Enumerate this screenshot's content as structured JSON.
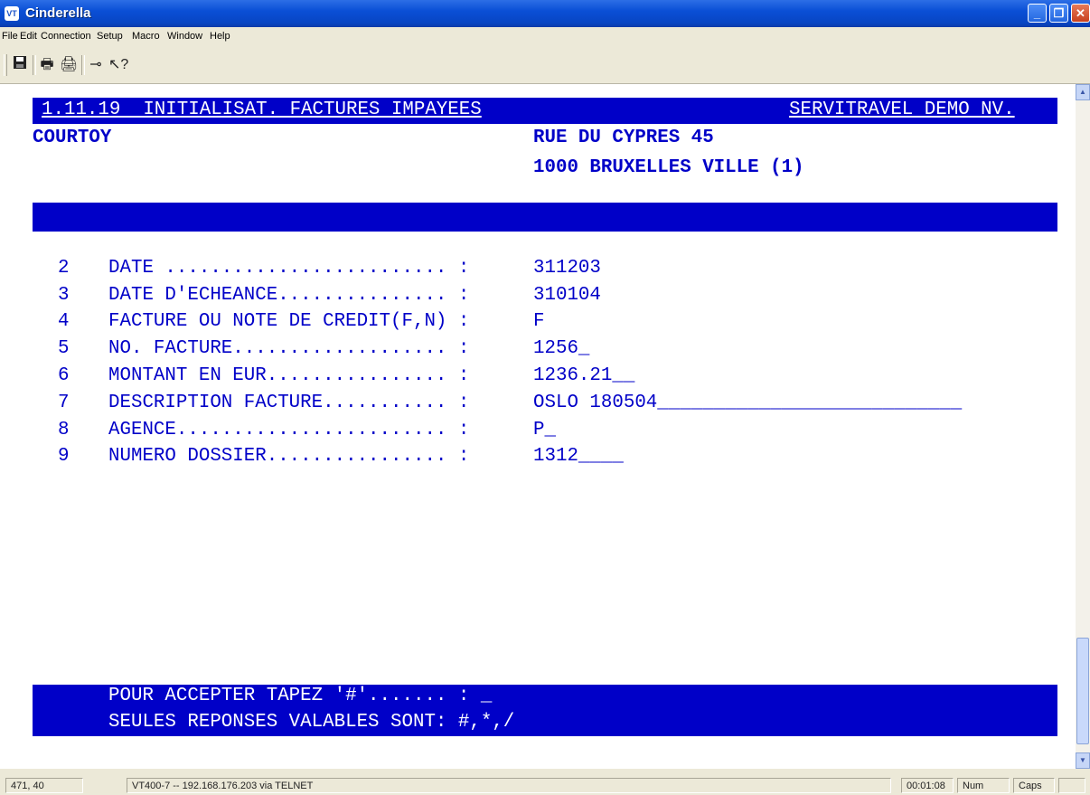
{
  "window": {
    "title": "Cinderella",
    "app_icon": "VT"
  },
  "menu": [
    "File",
    "Edit",
    "Connection",
    "Setup",
    "Macro",
    "Window",
    "Help"
  ],
  "toolbar": {
    "icons": [
      "save-icon",
      "print-icon",
      "print-setup-icon",
      "connect-icon",
      "help-icon"
    ]
  },
  "terminal": {
    "header_left": "1.11.19  INITIALISAT. FACTURES IMPAYEES",
    "header_right": "SERVITRAVEL DEMO NV.",
    "client_name": "COURTOY",
    "address_line1": "RUE DU CYPRES 45",
    "address_line2": "1000 BRUXELLES VILLE (1)",
    "fields": [
      {
        "num": "2",
        "label": "DATE ......................... :",
        "value": "311203"
      },
      {
        "num": "3",
        "label": "DATE D'ECHEANCE............... :",
        "value": "310104"
      },
      {
        "num": "4",
        "label": "FACTURE OU NOTE DE CREDIT(F,N) :",
        "value": "F"
      },
      {
        "num": "5",
        "label": "NO. FACTURE................... :",
        "value": "1256_"
      },
      {
        "num": "6",
        "label": "MONTANT EN EUR................ :",
        "value": "1236.21__"
      },
      {
        "num": "7",
        "label": "DESCRIPTION FACTURE........... :",
        "value": "OSLO 180504___________________________"
      },
      {
        "num": "8",
        "label": "AGENCE........................ :",
        "value": "P_"
      },
      {
        "num": "9",
        "label": "NUMERO DOSSIER................ :",
        "value": "1312____"
      }
    ],
    "prompt_line1": "POUR ACCEPTER TAPEZ '#'....... : _",
    "prompt_line2": "SEULES REPONSES VALABLES SONT: #,*,/"
  },
  "statusbar": {
    "cursor": "471, 40",
    "connection": "VT400-7 -- 192.168.176.203 via TELNET",
    "time": "00:01:08",
    "num": "Num",
    "caps": "Caps"
  },
  "colors": {
    "terminal_blue": "#0000c8",
    "titlebar": "#0a4fd6",
    "chrome": "#ece9d8"
  }
}
